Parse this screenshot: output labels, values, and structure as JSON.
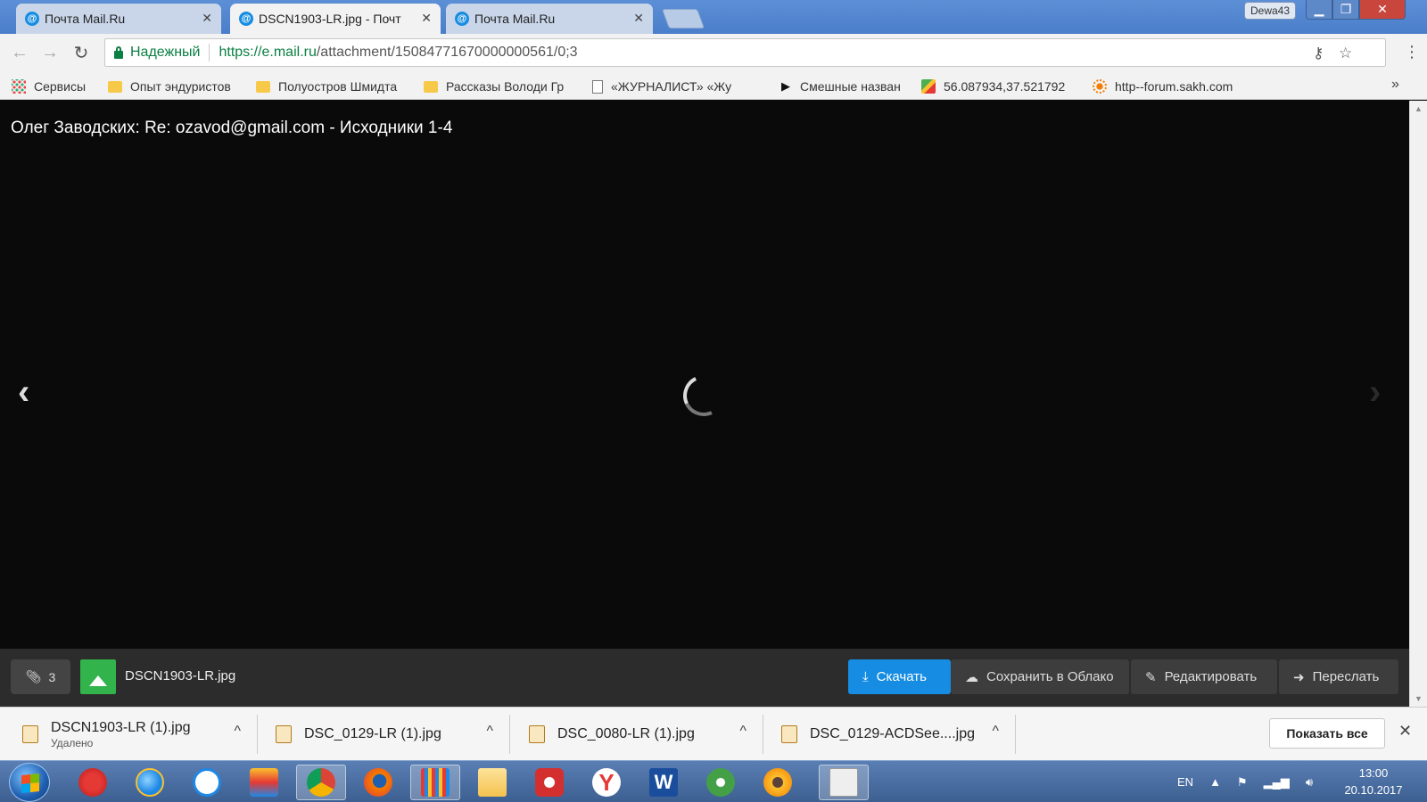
{
  "tabs": [
    {
      "title": "Почта Mail.Ru",
      "active": false
    },
    {
      "title": "DSCN1903-LR.jpg - Почт",
      "active": true
    },
    {
      "title": "Почта Mail.Ru",
      "active": false
    }
  ],
  "profile": "Dewa43",
  "address": {
    "secure_label": "Надежный",
    "host": "https://e.mail.ru",
    "path": "/attachment/15084771670000000561/0;3"
  },
  "bookmarks": [
    {
      "label": "Сервисы",
      "icon": "apps-grid-icon"
    },
    {
      "label": "Опыт эндуристов",
      "icon": "folder-icon"
    },
    {
      "label": "Полуостров Шмидта",
      "icon": "folder-icon"
    },
    {
      "label": "Рассказы Володи Гр",
      "icon": "folder-icon"
    },
    {
      "label": "«ЖУРНАЛИСТ» «Жу",
      "icon": "page-icon"
    },
    {
      "label": "Смешные назван",
      "icon": "play-icon"
    },
    {
      "label": "56.087934,37.521792",
      "icon": "map-icon"
    },
    {
      "label": "http--forum.sakh.com",
      "icon": "sun-icon"
    }
  ],
  "viewer": {
    "subject": "Олег Заводских: Re: ozavod@gmail.com - Исходники 1-4"
  },
  "attachment_bar": {
    "count": "3",
    "file_name": "DSCN1903-LR.jpg",
    "download": "Скачать",
    "save_cloud": "Сохранить в Облако",
    "edit": "Редактировать",
    "forward": "Переслать"
  },
  "downloads": [
    {
      "name": "DSCN1903-LR (1).jpg",
      "status": "Удалено"
    },
    {
      "name": "DSC_0129-LR (1).jpg",
      "status": ""
    },
    {
      "name": "DSC_0080-LR (1).jpg",
      "status": ""
    },
    {
      "name": "DSC_0129-ACDSee....jpg",
      "status": ""
    }
  ],
  "show_all": "Показать все",
  "taskbar": {
    "lang": "EN",
    "time": "13:00",
    "date": "20.10.2017"
  },
  "colors": {
    "accent_blue": "#168de2",
    "secure_green": "#0b8043",
    "thumb_green": "#32b34b"
  }
}
